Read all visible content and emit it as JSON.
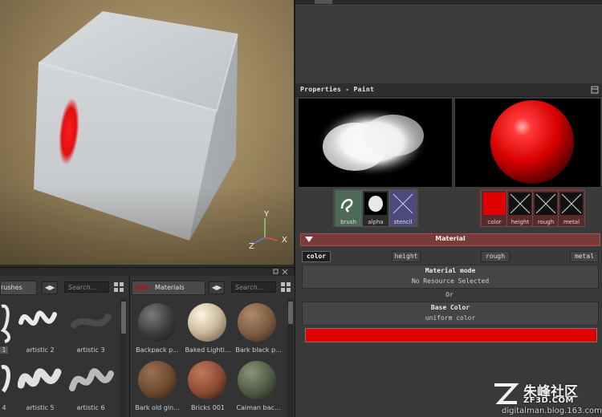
{
  "viewport": {
    "gizmo_axes": [
      "Y",
      "X",
      "Z"
    ],
    "colors": {
      "x": "#e05050",
      "y": "#8fd06a",
      "z": "#5a7fe0",
      "paint": "#e01010"
    }
  },
  "properties": {
    "title": "Properties - Paint",
    "tool_slots": [
      {
        "label": "brush",
        "icon": "brush-stroke-icon"
      },
      {
        "label": "alpha",
        "icon": "alpha-splatter-icon"
      },
      {
        "label": "stencil",
        "icon": "stencil-empty-icon"
      }
    ],
    "channel_slots": [
      {
        "label": "color",
        "icon": "color-red-swatch-icon"
      },
      {
        "label": "height",
        "icon": "empty-x-icon"
      },
      {
        "label": "rough",
        "icon": "empty-x-icon"
      },
      {
        "label": "metal",
        "icon": "empty-x-icon"
      }
    ],
    "material_section": "Material",
    "channels": [
      "color",
      "height",
      "rough",
      "metal"
    ],
    "active_channel": "color",
    "material_mode": {
      "heading": "Material mode",
      "value": "No Resource Selected"
    },
    "or_text": "Or",
    "base_color": {
      "heading": "Base Color",
      "value": "uniform color",
      "color": "#e00000"
    }
  },
  "brushes_panel": {
    "tab_label": "rushes",
    "search_placeholder": "Search...",
    "items": [
      {
        "label": "1"
      },
      {
        "label": "artistic 2"
      },
      {
        "label": "artistic 3"
      },
      {
        "label": "4"
      },
      {
        "label": "artistic 5"
      },
      {
        "label": "artistic 6"
      }
    ]
  },
  "materials_panel": {
    "tab_label": "Materials",
    "search_placeholder": "Search...",
    "items": [
      {
        "label": "Backpack p...",
        "color": "#3a3a3a"
      },
      {
        "label": "Baked Lighti...",
        "color": "#c9b79a"
      },
      {
        "label": "Bark black p...",
        "color": "#7a5a40"
      },
      {
        "label": "Bark old gin...",
        "color": "#6b4a2e"
      },
      {
        "label": "Bricks 001",
        "color": "#8a4a32"
      },
      {
        "label": "Caiman bac...",
        "color": "#4f5a44"
      }
    ]
  },
  "watermark": {
    "cn_text": "朱峰社区",
    "domain": "ZF3D.COM",
    "blog": "digitalman.blog.163.com"
  }
}
